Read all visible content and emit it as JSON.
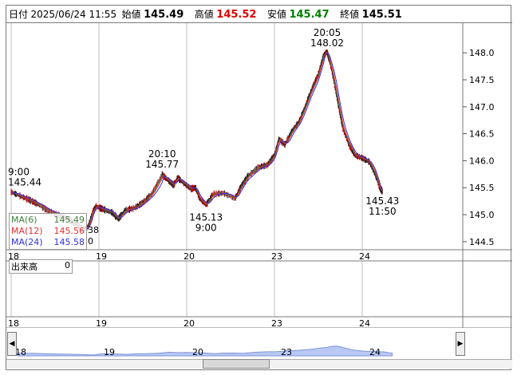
{
  "header": {
    "date_label": "日付",
    "datetime": "2025/06/24 11:55",
    "open_label": "始値",
    "open": "145.49",
    "high_label": "高値",
    "high": "145.52",
    "low_label": "安値",
    "low": "145.47",
    "close_label": "終値",
    "close": "145.51",
    "colors": {
      "high": "#e00000",
      "low": "#008000"
    }
  },
  "legend": [
    {
      "label": "MA(6)",
      "value": "145.49",
      "color": "#408040"
    },
    {
      "label": "MA(12)",
      "value": "145.56",
      "color": "#e03030"
    },
    {
      "label": "MA(24)",
      "value": "145.58",
      "color": "#3030e0"
    }
  ],
  "legend_overflow": {
    "top": "38",
    "bottom": "0"
  },
  "volume": {
    "label": "出来高",
    "value": "0"
  },
  "chart_data": {
    "type": "line",
    "ylim": [
      144.35,
      148.55
    ],
    "yticks": [
      "148.0",
      "147.5",
      "147.0",
      "146.5",
      "146.0",
      "145.5",
      "145.0",
      "144.5"
    ],
    "ytick_values": [
      148.0,
      147.5,
      147.0,
      146.5,
      146.0,
      145.5,
      145.0,
      144.5
    ],
    "xticks": [
      "18",
      "19",
      "20",
      "23",
      "24"
    ],
    "xtick_pos": [
      0,
      1,
      2,
      3,
      4
    ],
    "x_max": 5.1,
    "series": [
      {
        "values": [
          [
            0.0,
            145.42
          ],
          [
            0.1,
            145.35
          ],
          [
            0.2,
            145.28
          ],
          [
            0.3,
            145.2
          ],
          [
            0.42,
            145.07
          ],
          [
            0.55,
            144.98
          ],
          [
            0.65,
            144.92
          ],
          [
            0.75,
            144.82
          ],
          [
            0.82,
            144.72
          ],
          [
            0.88,
            144.78
          ],
          [
            0.93,
            145.05
          ],
          [
            0.97,
            145.15
          ],
          [
            1.05,
            145.1
          ],
          [
            1.15,
            145.04
          ],
          [
            1.22,
            144.92
          ],
          [
            1.3,
            145.08
          ],
          [
            1.4,
            145.12
          ],
          [
            1.5,
            145.22
          ],
          [
            1.6,
            145.38
          ],
          [
            1.72,
            145.74
          ],
          [
            1.78,
            145.65
          ],
          [
            1.85,
            145.55
          ],
          [
            1.9,
            145.68
          ],
          [
            1.97,
            145.58
          ],
          [
            2.05,
            145.48
          ],
          [
            2.1,
            145.5
          ],
          [
            2.15,
            145.3
          ],
          [
            2.22,
            145.18
          ],
          [
            2.3,
            145.38
          ],
          [
            2.42,
            145.4
          ],
          [
            2.55,
            145.3
          ],
          [
            2.62,
            145.52
          ],
          [
            2.7,
            145.72
          ],
          [
            2.82,
            145.88
          ],
          [
            2.92,
            145.92
          ],
          [
            3.0,
            146.1
          ],
          [
            3.05,
            146.4
          ],
          [
            3.12,
            146.3
          ],
          [
            3.2,
            146.55
          ],
          [
            3.28,
            146.72
          ],
          [
            3.35,
            147.0
          ],
          [
            3.42,
            147.3
          ],
          [
            3.5,
            147.6
          ],
          [
            3.56,
            147.95
          ],
          [
            3.6,
            148.02
          ],
          [
            3.65,
            147.7
          ],
          [
            3.72,
            147.1
          ],
          [
            3.78,
            146.6
          ],
          [
            3.85,
            146.3
          ],
          [
            3.92,
            146.1
          ],
          [
            4.0,
            146.05
          ],
          [
            4.08,
            145.98
          ],
          [
            4.15,
            145.75
          ],
          [
            4.2,
            145.5
          ],
          [
            4.23,
            145.43
          ]
        ]
      }
    ],
    "annotations": [
      {
        "time": "9:00",
        "value": "145.44",
        "x": 0.0,
        "y": 145.44,
        "pos": "above"
      },
      {
        "time": "20:10",
        "value": "145.77",
        "x": 1.72,
        "y": 145.77,
        "pos": "above"
      },
      {
        "time": "9:00",
        "value": "145.13",
        "x": 2.22,
        "y": 145.13,
        "pos": "below"
      },
      {
        "time": "20:05",
        "value": "148.02",
        "x": 3.6,
        "y": 148.02,
        "pos": "above"
      },
      {
        "time": "11:50",
        "value": "145.43",
        "x": 4.23,
        "y": 145.43,
        "pos": "below"
      }
    ]
  },
  "navigator": {
    "xticks": [
      "18",
      "19",
      "20",
      "23",
      "24"
    ],
    "left_arrow": "◀",
    "right_arrow": "▶"
  }
}
